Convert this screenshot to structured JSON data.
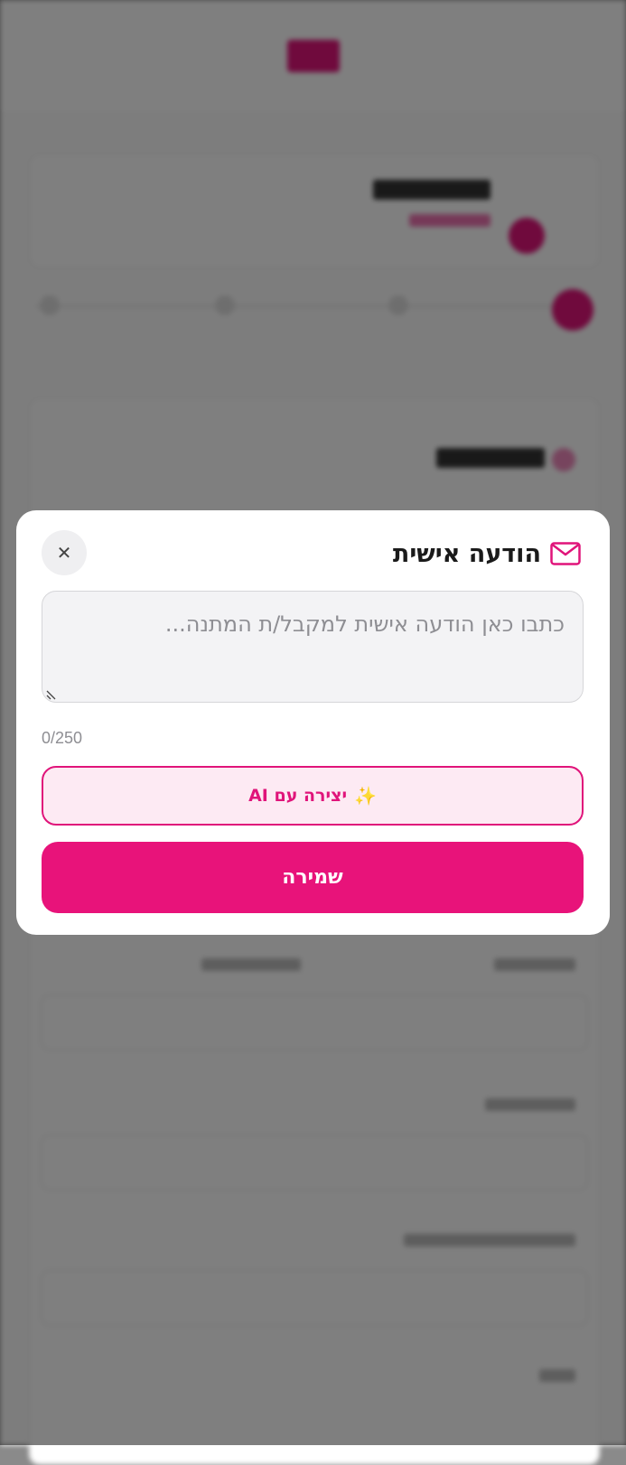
{
  "modal": {
    "title": "הודעה אישית",
    "title_icon": "envelope-icon",
    "close_icon": "close-icon",
    "close_symbol": "✕",
    "message_placeholder": "כתבו כאן הודעה אישית למקבל/ת המתנה...",
    "message_value": "",
    "char_count": "0/250",
    "ai_button": {
      "label": "יצירה עם AI",
      "icon": "sparkles-icon",
      "icon_glyph": "✨"
    },
    "save_button": {
      "label": "שמירה"
    }
  },
  "colors": {
    "accent": "#e8137a",
    "accent_light": "#fdeaf3",
    "overlay": "rgba(0,0,0,0.5)",
    "input_bg": "#f3f3f5"
  }
}
